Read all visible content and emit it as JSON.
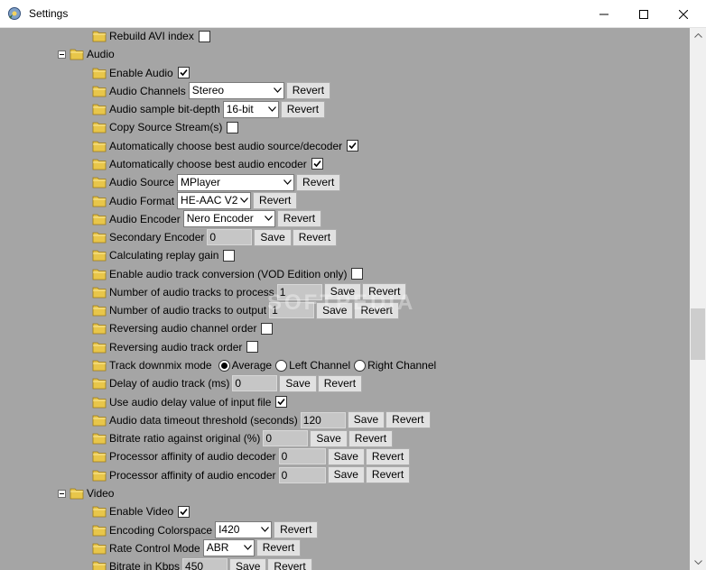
{
  "window": {
    "title": "Settings"
  },
  "watermark": "SOFTPEDIA",
  "colors": {
    "content_bg": "#a5a5a5",
    "field_bg": "#c6c6c6",
    "folder": "#e8c64a"
  },
  "tree": [
    {
      "kind": "item",
      "label": "Rebuild AVI index",
      "checkbox": false
    },
    {
      "kind": "group",
      "label": "Audio"
    },
    {
      "kind": "item",
      "label": "Enable Audio",
      "checkbox": true
    },
    {
      "kind": "item",
      "label": "Audio Channels",
      "select": "Stereo",
      "select_w": 106,
      "buttons": [
        "Revert"
      ]
    },
    {
      "kind": "item",
      "label": "Audio sample bit-depth",
      "select": "16-bit",
      "select_w": 62,
      "buttons": [
        "Revert"
      ]
    },
    {
      "kind": "item",
      "label": "Copy Source Stream(s)",
      "checkbox": false
    },
    {
      "kind": "item",
      "label": "Automatically choose best audio source/decoder",
      "checkbox": true
    },
    {
      "kind": "item",
      "label": "Automatically choose best audio encoder",
      "checkbox": true
    },
    {
      "kind": "item",
      "label": "Audio Source",
      "select": "MPlayer",
      "select_w": 130,
      "buttons": [
        "Revert"
      ]
    },
    {
      "kind": "item",
      "label": "Audio Format",
      "select": "HE-AAC V2",
      "select_w": 82,
      "buttons": [
        "Revert"
      ]
    },
    {
      "kind": "item",
      "label": "Audio Encoder",
      "select": "Nero Encoder",
      "select_w": 102,
      "buttons": [
        "Revert"
      ]
    },
    {
      "kind": "item",
      "label": "Secondary Encoder",
      "field": "0",
      "field_w": 50,
      "buttons": [
        "Save",
        "Revert"
      ]
    },
    {
      "kind": "item",
      "label": "Calculating replay gain",
      "checkbox": false
    },
    {
      "kind": "item",
      "label": "Enable audio track conversion (VOD Edition only)",
      "checkbox": false
    },
    {
      "kind": "item",
      "label": "Number of audio tracks to process",
      "field": "1",
      "field_w": 50,
      "buttons": [
        "Save",
        "Revert"
      ]
    },
    {
      "kind": "item",
      "label": "Number of audio tracks to output",
      "field": "1",
      "field_w": 50,
      "buttons": [
        "Save",
        "Revert"
      ]
    },
    {
      "kind": "item",
      "label": "Reversing audio channel order",
      "checkbox": false
    },
    {
      "kind": "item",
      "label": "Reversing audio track order",
      "checkbox": false
    },
    {
      "kind": "item",
      "label": "Track downmix mode",
      "radios": [
        {
          "label": "Average",
          "on": true
        },
        {
          "label": "Left Channel",
          "on": false
        },
        {
          "label": "Right Channel",
          "on": false
        }
      ]
    },
    {
      "kind": "item",
      "label": "Delay of audio track (ms)",
      "field": "0",
      "field_w": 50,
      "buttons": [
        "Save",
        "Revert"
      ]
    },
    {
      "kind": "item",
      "label": "Use audio delay value of input file",
      "checkbox": true
    },
    {
      "kind": "item",
      "label": "Audio data timeout threshold (seconds)",
      "field": "120",
      "field_w": 50,
      "buttons": [
        "Save",
        "Revert"
      ]
    },
    {
      "kind": "item",
      "label": "Bitrate ratio against original (%)",
      "field": "0",
      "field_w": 50,
      "buttons": [
        "Save",
        "Revert"
      ]
    },
    {
      "kind": "item",
      "label": "Processor affinity of audio decoder",
      "field": "0",
      "field_w": 52,
      "buttons": [
        "Save",
        "Revert"
      ]
    },
    {
      "kind": "item",
      "label": "Processor affinity of audio encoder",
      "field": "0",
      "field_w": 52,
      "buttons": [
        "Save",
        "Revert"
      ]
    },
    {
      "kind": "group",
      "label": "Video"
    },
    {
      "kind": "item",
      "label": "Enable Video",
      "checkbox": true
    },
    {
      "kind": "item",
      "label": "Encoding Colorspace",
      "select": "I420",
      "select_w": 63,
      "buttons": [
        "Revert"
      ]
    },
    {
      "kind": "item",
      "label": "Rate Control Mode",
      "select": "ABR",
      "select_w": 57,
      "buttons": [
        "Revert"
      ]
    },
    {
      "kind": "item",
      "label": "Bitrate in Kbps",
      "field": "450",
      "field_w": 50,
      "buttons": [
        "Save",
        "Revert"
      ]
    }
  ]
}
